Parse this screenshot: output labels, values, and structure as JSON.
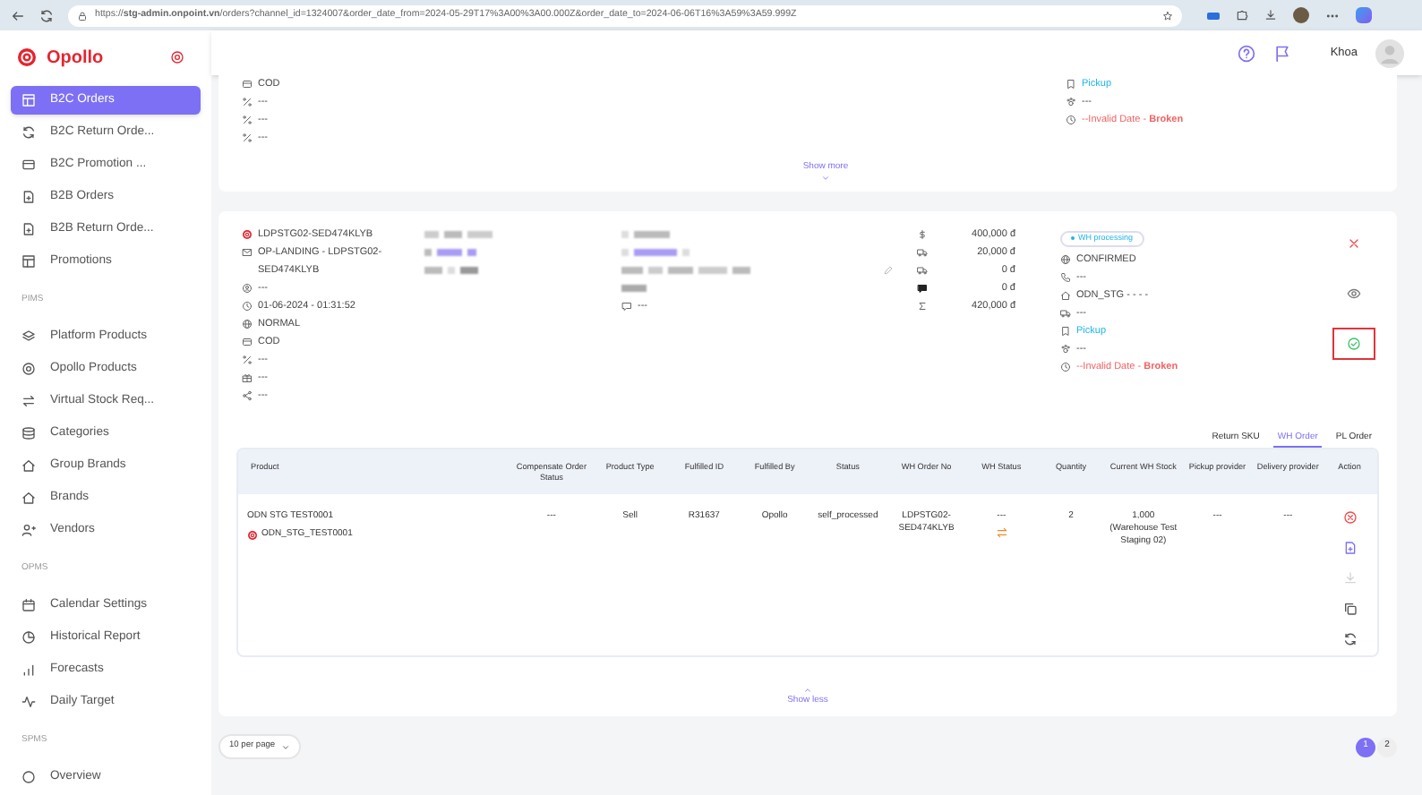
{
  "browser": {
    "url": "https://**stg-admin.onpoint.vn**/orders?channel_id=1324007&order_date_from=2024-05-29T17%3A00%3A00.000Z&order_date_to=2024-06-06T16%3A59%3A59.999Z"
  },
  "sidebar": {
    "logo": "Opollo",
    "sections": [
      {
        "items": [
          {
            "label": "B2C Orders",
            "selected": true
          },
          {
            "label": "B2C Return Orde...",
            "selected": false
          },
          {
            "label": "B2C Promotion ...",
            "selected": false
          },
          {
            "label": "B2B Orders",
            "selected": false
          },
          {
            "label": "B2B Return Orde...",
            "selected": false
          },
          {
            "label": "Promotions",
            "selected": false
          }
        ]
      },
      {
        "heading": "PIMS",
        "items": [
          {
            "label": "Platform Products",
            "selected": false
          },
          {
            "label": "Opollo Products",
            "selected": false
          },
          {
            "label": "Virtual Stock Req...",
            "selected": false
          },
          {
            "label": "Categories",
            "selected": false
          },
          {
            "label": "Group Brands",
            "selected": false
          },
          {
            "label": "Brands",
            "selected": false
          },
          {
            "label": "Vendors",
            "selected": false
          }
        ]
      },
      {
        "heading": "OPMS",
        "items": [
          {
            "label": "Calendar Settings",
            "selected": false
          },
          {
            "label": "Historical Report",
            "selected": false
          },
          {
            "label": "Forecasts",
            "selected": false
          },
          {
            "label": "Daily Target",
            "selected": false
          }
        ]
      },
      {
        "heading": "SPMS",
        "items": [
          {
            "label": "Overview",
            "selected": false
          }
        ]
      }
    ]
  },
  "header": {
    "user": "Khoa"
  },
  "previous_order": {
    "info": [
      "COD",
      "---",
      "---",
      "---"
    ],
    "fulfillment": [
      {
        "kind": "link",
        "text": "Pickup"
      },
      {
        "kind": "plain",
        "text": "---"
      },
      {
        "kind": "deadline",
        "text": "--Invalid Date - **Broken**"
      }
    ],
    "toggle": "Show more"
  },
  "order": {
    "info": [
      {
        "kind": "code",
        "text": "LDPSTG02-SED474KLYB"
      },
      {
        "kind": "plain",
        "text": "OP-LANDING - LDPSTG02-SED474KLYB"
      },
      {
        "kind": "plain",
        "text": "---"
      },
      {
        "kind": "plain",
        "text": "01-06-2024 - 01:31:52"
      },
      {
        "kind": "plain",
        "text": "NORMAL"
      },
      {
        "kind": "plain",
        "text": "COD"
      },
      {
        "kind": "plain",
        "text": "---"
      },
      {
        "kind": "plain",
        "text": "---"
      },
      {
        "kind": "plain",
        "text": "---"
      }
    ],
    "note": "---",
    "amounts": [
      "400,000 đ",
      "20,000 đ",
      "0 đ",
      "0 đ",
      "420,000 đ"
    ],
    "status_badge": "WH processing",
    "status": [
      {
        "kind": "plain",
        "text": "CONFIRMED"
      },
      {
        "kind": "plain",
        "text": "---"
      },
      {
        "kind": "plain",
        "text": "ODN_STG - - - -"
      },
      {
        "kind": "plain",
        "text": "---"
      },
      {
        "kind": "link",
        "text": "Pickup"
      },
      {
        "kind": "plain",
        "text": "---"
      },
      {
        "kind": "deadline",
        "text": "--Invalid Date - **Broken**"
      }
    ],
    "actions": [
      {
        "kind": "cancel",
        "highlighted": false
      },
      {
        "kind": "view",
        "highlighted": false
      },
      {
        "kind": "confirm",
        "highlighted": true
      }
    ],
    "tabs": [
      {
        "label": "Return SKU",
        "selected": false
      },
      {
        "label": "WH Order",
        "selected": true
      },
      {
        "label": "PL Order",
        "selected": false
      }
    ],
    "table": {
      "columns": [
        "Product",
        "Compensate Order Status",
        "Product Type",
        "Fulfilled ID",
        "Fulfilled By",
        "Status",
        "WH Order No",
        "WH Status",
        "Quantity",
        "Current WH Stock",
        "Pickup provider",
        "Delivery provider",
        "Action"
      ],
      "rows": [
        {
          "sku": "ODN_STG_TEST0001",
          "cells": [
            "ODN STG TEST0001",
            "---",
            "Sell",
            "R31637",
            "Opollo",
            "self_processed",
            "LDPSTG02-SED474KLYB",
            "---",
            "2",
            "1,000 (Warehouse Test Staging 02)",
            "---",
            "---"
          ],
          "actions": [
            {
              "kind": "cancel",
              "disabled": false
            },
            {
              "kind": "document",
              "disabled": false
            },
            {
              "kind": "download",
              "disabled": true
            },
            {
              "kind": "copy",
              "disabled": false
            },
            {
              "kind": "refresh",
              "disabled": false
            }
          ]
        }
      ]
    },
    "toggle": "Show less"
  },
  "pagination": {
    "per_page": "10 per page",
    "pages": [
      {
        "label": "1",
        "selected": true
      },
      {
        "label": "2",
        "selected": false
      }
    ]
  }
}
